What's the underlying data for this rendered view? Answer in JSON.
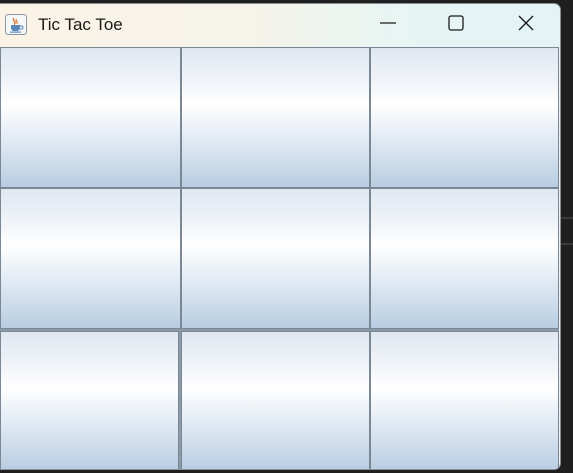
{
  "window": {
    "title": "Tic Tac Toe",
    "app_icon": "java-coffee-cup-icon",
    "controls": [
      "minimize-icon",
      "maximize-icon",
      "close-icon"
    ]
  },
  "board": {
    "rows": 3,
    "cols": 3,
    "cells": [
      [
        "",
        "",
        ""
      ],
      [
        "",
        "",
        ""
      ],
      [
        "",
        "",
        ""
      ]
    ]
  },
  "colors": {
    "cell_border": "#7a8795",
    "cell_gradient_top": "#dfe7f0",
    "cell_gradient_mid": "#ffffff",
    "cell_gradient_bottom": "#b8cde2",
    "titlebar_left": "#fbf3e6",
    "titlebar_right": "#e3f3f6"
  }
}
